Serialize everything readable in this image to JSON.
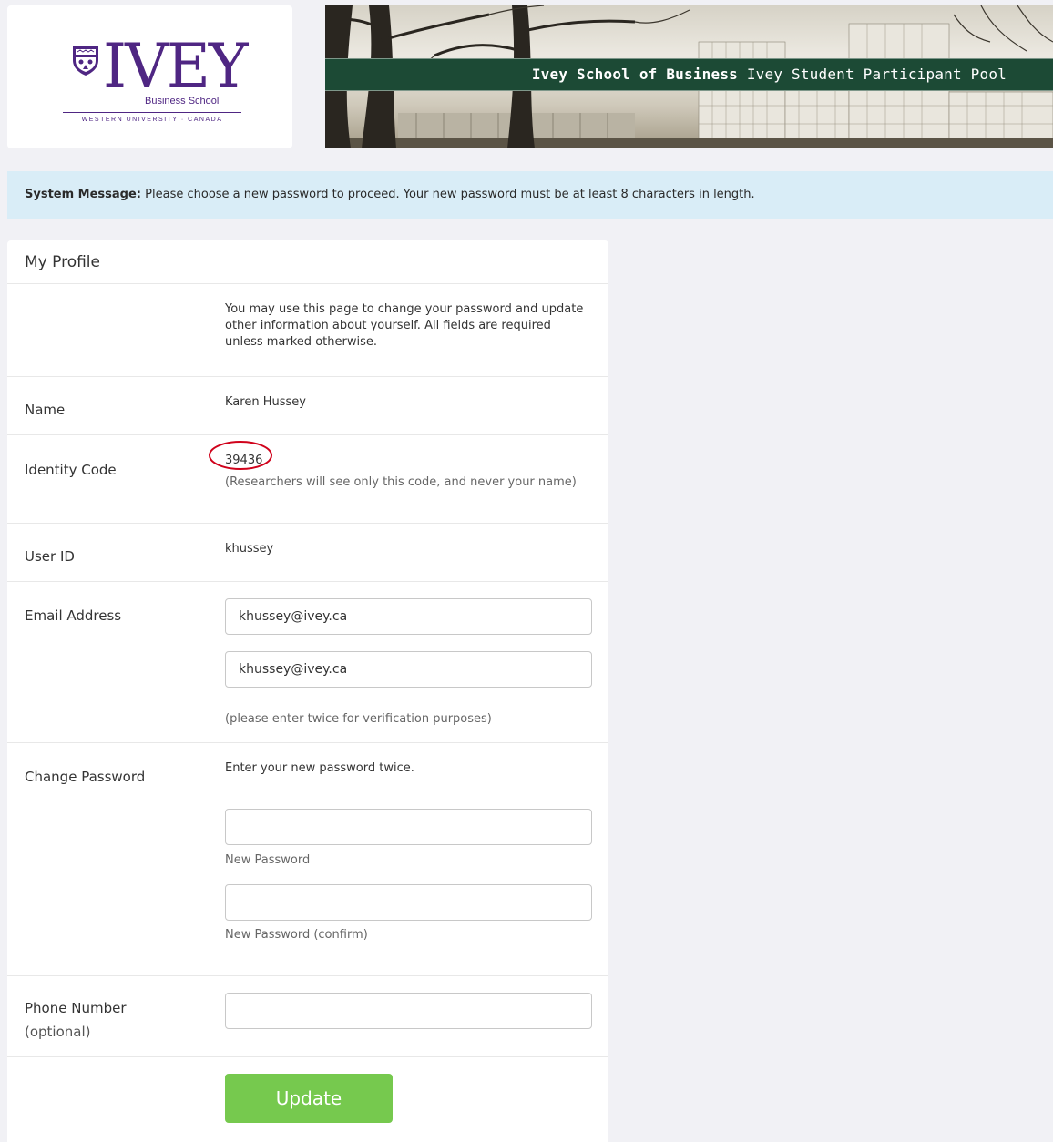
{
  "header": {
    "logo": {
      "wordmark": "IVEY",
      "school": "Business School",
      "university": "WESTERN UNIVERSITY · CANADA"
    },
    "banner": {
      "school_name": "Ivey School of Business",
      "site_name": "Ivey Student Participant Pool"
    }
  },
  "system_message": {
    "label": "System Message:",
    "text": "Please choose a new password to proceed. Your new password must be at least 8 characters in length."
  },
  "profile": {
    "title": "My Profile",
    "intro": "You may use this page to change your password and update other information about yourself. All fields are required unless marked otherwise.",
    "name": {
      "label": "Name",
      "value": "Karen Hussey"
    },
    "identity_code": {
      "label": "Identity Code",
      "value": "39436",
      "note": "(Researchers will see only this code, and never your name)"
    },
    "user_id": {
      "label": "User ID",
      "value": "khussey"
    },
    "email": {
      "label": "Email Address",
      "value": "khussey@ivey.ca",
      "confirm_value": "khussey@ivey.ca",
      "note": "(please enter twice for verification purposes)"
    },
    "password": {
      "label": "Change Password",
      "instruction": "Enter your new password twice.",
      "new_label": "New Password",
      "confirm_label": "New Password (confirm)",
      "new_value": "",
      "confirm_value": ""
    },
    "phone": {
      "label": "Phone Number",
      "optional": "(optional)",
      "value": ""
    },
    "update_label": "Update"
  },
  "colors": {
    "brand_purple": "#4f2683",
    "banner_green": "#1c4a35",
    "message_bg": "#d9edf7",
    "button_green": "#76c94e",
    "annotation_red": "#d0021b"
  }
}
